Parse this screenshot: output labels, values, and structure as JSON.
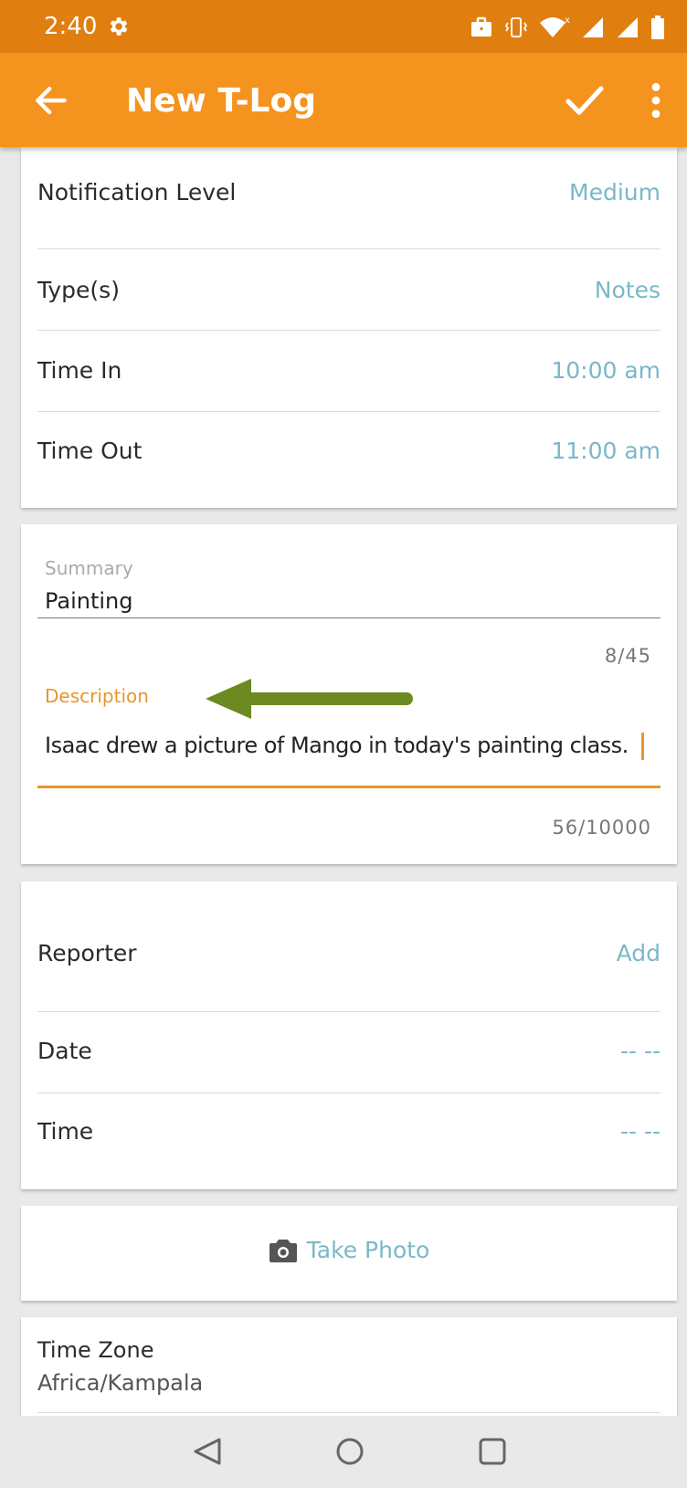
{
  "status_bar": {
    "time": "2:40"
  },
  "app_bar": {
    "title": "New T-Log"
  },
  "details": {
    "notification_level": {
      "label": "Notification Level",
      "value": "Medium"
    },
    "types": {
      "label": "Type(s)",
      "value": "Notes"
    },
    "time_in": {
      "label": "Time In",
      "value": "10:00 am"
    },
    "time_out": {
      "label": "Time Out",
      "value": "11:00 am"
    }
  },
  "summary": {
    "label": "Summary",
    "value": "Painting",
    "counter": "8/45"
  },
  "description": {
    "label": "Description",
    "value": "Isaac drew a picture of Mango in today's painting class.",
    "counter": "56/10000"
  },
  "reporter_section": {
    "reporter": {
      "label": "Reporter",
      "value": "Add"
    },
    "date": {
      "label": "Date",
      "value": "-- --"
    },
    "time": {
      "label": "Time",
      "value": "-- --"
    }
  },
  "photo": {
    "label": "Take Photo"
  },
  "timezone": {
    "label": "Time Zone",
    "value": "Africa/Kampala"
  },
  "colors": {
    "status_bar": "#e07f10",
    "app_bar": "#f5931f",
    "accent": "#e8962a",
    "link": "#7ab8c8",
    "arrow": "#6b8a1f"
  },
  "icons": [
    "gear-icon",
    "briefcase-icon",
    "vibrate-icon",
    "wifi-icon",
    "signal-icon",
    "battery-icon",
    "back-arrow-icon",
    "check-icon",
    "more-vert-icon",
    "camera-icon",
    "nav-back-icon",
    "nav-home-icon",
    "nav-recents-icon"
  ]
}
